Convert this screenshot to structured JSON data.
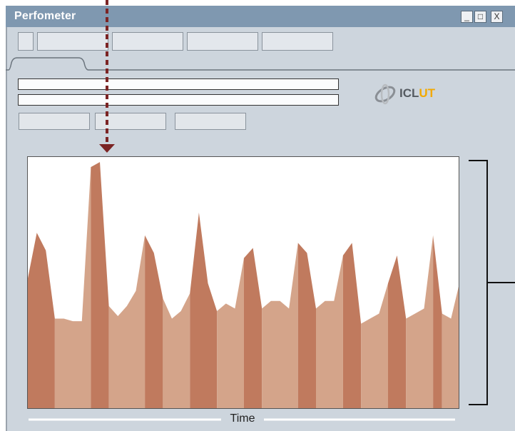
{
  "window": {
    "title": "Perfometer"
  },
  "window_controls": {
    "minimize": "_",
    "maximize": "□",
    "close": "X"
  },
  "logo": {
    "text_part1": "ICL",
    "text_part2": "UT"
  },
  "chart_data": {
    "type": "area",
    "xlabel": "Time",
    "ylabel": "",
    "series": [
      {
        "name": "",
        "values": [
          52,
          70,
          63,
          36,
          36,
          35,
          35,
          96,
          98,
          41,
          37,
          41,
          47,
          69,
          62,
          44,
          36,
          39,
          46,
          78,
          50,
          39,
          42,
          40,
          60,
          64,
          40,
          43,
          43,
          40,
          66,
          62,
          40,
          43,
          43,
          61,
          66,
          34,
          36,
          38,
          50,
          61,
          36,
          38,
          40,
          69,
          38,
          36,
          51
        ]
      }
    ]
  }
}
